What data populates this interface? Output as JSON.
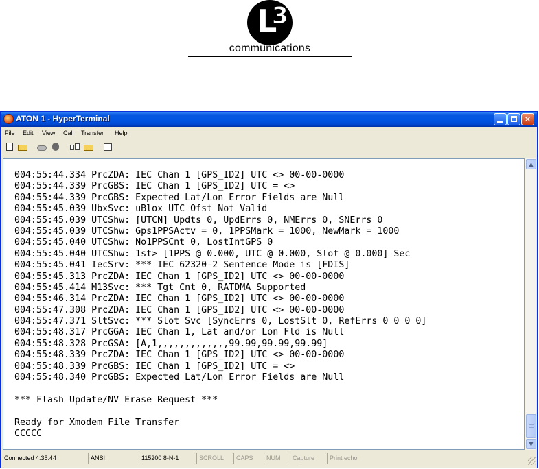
{
  "logo": {
    "letter": "L",
    "digit": "3",
    "wordmark": "communications"
  },
  "window": {
    "title": "ATON 1 - HyperTerminal",
    "controls": {
      "minimize": "",
      "maximize": "",
      "close": "✕"
    }
  },
  "menu": [
    "File",
    "Edit",
    "View",
    "Call",
    "Transfer",
    "Help"
  ],
  "toolbar": {
    "icons": [
      "new-document-icon",
      "open-folder-icon",
      "dial-phone-icon",
      "hangup-phone-icon",
      "send-file-icon",
      "receive-file-icon",
      "properties-icon"
    ]
  },
  "terminal": {
    "lines": [
      "004:55:44.334 PrcZDA: IEC Chan 1 [GPS_ID2] UTC <> 00-00-0000",
      "004:55:44.339 PrcGBS: IEC Chan 1 [GPS_ID2] UTC = <>",
      "004:55:44.339 PrcGBS: Expected Lat/Lon Error Fields are Null",
      "004:55:45.039 UbxSvc: uBlox UTC Ofst Not Valid",
      "004:55:45.039 UTCShw: [UTCN] Updts 0, UpdErrs 0, NMErrs 0, SNErrs 0",
      "004:55:45.039 UTCShw: Gps1PPSActv = 0, 1PPSMark = 1000, NewMark = 1000",
      "004:55:45.040 UTCShw: No1PPSCnt 0, LostIntGPS 0",
      "004:55:45.040 UTCShw: 1st> [1PPS @ 0.000, UTC @ 0.000, Slot @ 0.000] Sec",
      "004:55:45.041 IecSrv: *** IEC 62320-2 Sentence Mode is [FDIS]",
      "004:55:45.313 PrcZDA: IEC Chan 1 [GPS_ID2] UTC <> 00-00-0000",
      "004:55:45.414 M13Svc: *** Tgt Cnt 0, RATDMA Supported",
      "004:55:46.314 PrcZDA: IEC Chan 1 [GPS_ID2] UTC <> 00-00-0000",
      "004:55:47.308 PrcZDA: IEC Chan 1 [GPS_ID2] UTC <> 00-00-0000",
      "004:55:47.371 SltSvc: *** Slot Svc [SyncErrs 0, LostSlt 0, RefErrs 0 0 0 0]",
      "004:55:48.317 PrcGGA: IEC Chan 1, Lat and/or Lon Fld is Null",
      "004:55:48.328 PrcGSA: [A,1,,,,,,,,,,,,,99.99,99.99,99.99]",
      "004:55:48.339 PrcZDA: IEC Chan 1 [GPS_ID2] UTC <> 00-00-0000",
      "004:55:48.339 PrcGBS: IEC Chan 1 [GPS_ID2] UTC = <>",
      "004:55:48.340 PrcGBS: Expected Lat/Lon Error Fields are Null",
      "",
      "*** Flash Update/NV Erase Request ***",
      "",
      "Ready for Xmodem File Transfer",
      "CCCCC"
    ]
  },
  "statusbar": {
    "connected": "Connected 4:35:44",
    "emulation": "ANSI",
    "settings": "115200 8-N-1",
    "scroll": "SCROLL",
    "caps": "CAPS",
    "num": "NUM",
    "capture": "Capture",
    "print_echo": "Print echo"
  }
}
